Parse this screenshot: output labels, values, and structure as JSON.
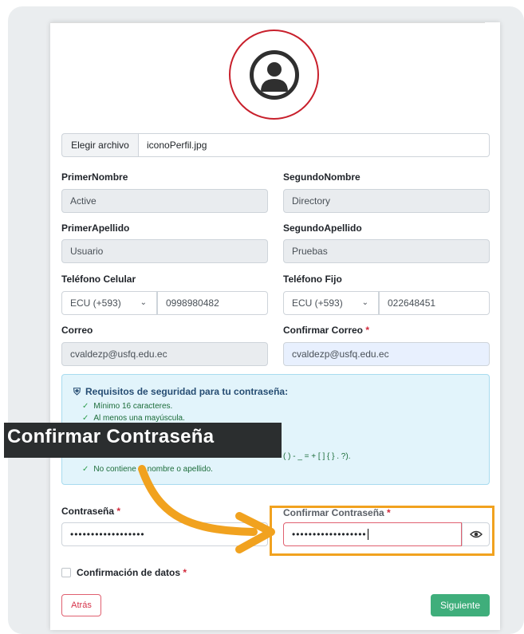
{
  "file": {
    "button_label": "Elegir archivo",
    "file_name": "iconoPerfil.jpg"
  },
  "form": {
    "primer_nombre": {
      "label": "PrimerNombre",
      "value": "Active"
    },
    "segundo_nombre": {
      "label": "SegundoNombre",
      "value": "Directory"
    },
    "primer_apellido": {
      "label": "PrimerApellido",
      "value": "Usuario"
    },
    "segundo_apellido": {
      "label": "SegundoApellido",
      "value": "Pruebas"
    },
    "telefono_celular": {
      "label": "Teléfono Celular",
      "country": "ECU (+593)",
      "value": "0998980482"
    },
    "telefono_fijo": {
      "label": "Teléfono Fijo",
      "country": "ECU (+593)",
      "value": "022648451"
    },
    "correo": {
      "label": "Correo",
      "value": "cvaldezp@usfq.edu.ec"
    },
    "confirmar_correo": {
      "label": "Confirmar Correo",
      "required": "*",
      "value": "cvaldezp@usfq.edu.ec"
    },
    "contrasena": {
      "label": "Contraseña",
      "required": "*",
      "value": "••••••••••••••••••"
    },
    "confirmar_contrasena": {
      "label": "Confirmar Contraseña",
      "required": "*",
      "value": "••••••••••••••••••"
    },
    "confirmacion_datos": {
      "label": "Confirmación de datos",
      "required": "*"
    }
  },
  "requirements": {
    "title": "Requisitos de seguridad para tu contraseña:",
    "items": [
      "Mínimo 16 caracteres.",
      "Al menos una mayúscula.",
      "( ) - _ = + [ ] { } . ?).",
      "No contiene tu nombre o apellido."
    ]
  },
  "banner": {
    "text": "Confirmar Contraseña"
  },
  "buttons": {
    "back": "Atrás",
    "next": "Siguiente"
  },
  "colors": {
    "highlight": "#f1a21f",
    "success": "#3fae7b",
    "danger": "#d6334a",
    "info_bg": "#e2f4fb"
  }
}
